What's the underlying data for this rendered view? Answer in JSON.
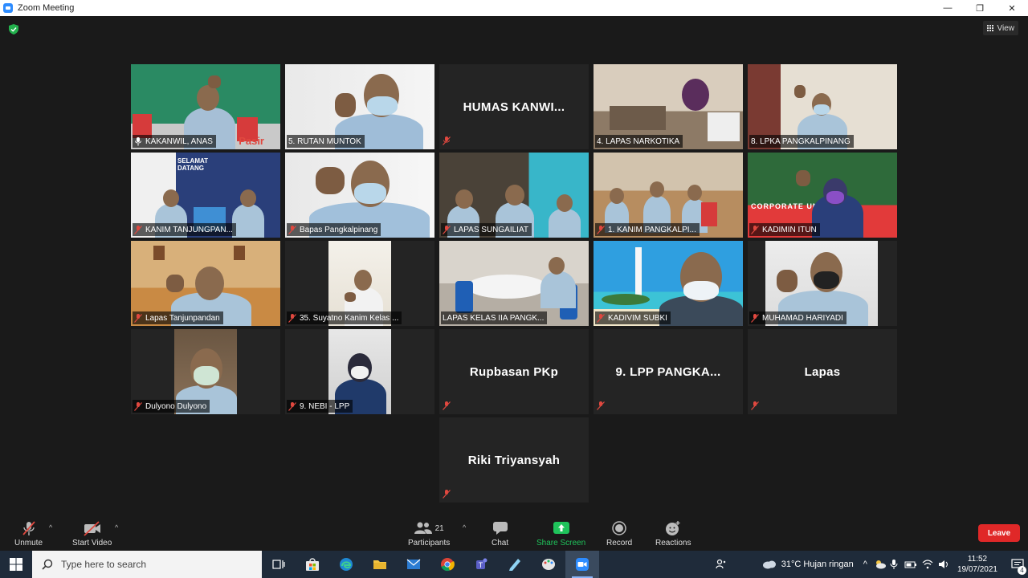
{
  "window": {
    "title": "Zoom Meeting",
    "controls": {
      "minimize": "—",
      "maximize": "❐",
      "close": "✕"
    }
  },
  "view_button": {
    "label": "View"
  },
  "tiles": [
    {
      "label": "KAKANWIL, ANAS",
      "active": true
    },
    {
      "label": "5. RUTAN MUNTOK"
    },
    {
      "name_text": "HUMAS  KANWI..."
    },
    {
      "label": "4. LAPAS NARKOTIKA"
    },
    {
      "label": "8. LPKA PANGKALPINANG"
    },
    {
      "label": "KANIM TANJUNGPAN..."
    },
    {
      "label": "Bapas Pangkalpinang"
    },
    {
      "label": "LAPAS SUNGAILIAT"
    },
    {
      "label": "1. KANIM PANGKALPI..."
    },
    {
      "label": "KADIMIN ITUN"
    },
    {
      "label": "Lapas Tanjunpandan"
    },
    {
      "label": "35. Suyatno Kanim Kelas ..."
    },
    {
      "label": "LAPAS KELAS IIA PANGK..."
    },
    {
      "label": "KADIVIM SUBKI"
    },
    {
      "label": "MUHAMAD HARIYADI"
    },
    {
      "label": "Dulyono Dulyono"
    },
    {
      "label": "9. NEBI - LPP"
    },
    {
      "name_text": "Rupbasan PKp"
    },
    {
      "name_text": "9.  LPP  PANGKA..."
    },
    {
      "name_text": "Lapas"
    },
    {
      "name_text": "Riki Triyansyah"
    }
  ],
  "backdrop_text": {
    "welcome": "SELAMAT DATANG",
    "university": "CORPORATE UNIVERSITY",
    "pasir": "Pasir"
  },
  "toolbar": {
    "unmute": "Unmute",
    "start_video": "Start Video",
    "participants": "Participants",
    "participants_count": "21",
    "chat": "Chat",
    "share_screen": "Share Screen",
    "record": "Record",
    "reactions": "Reactions",
    "leave": "Leave"
  },
  "taskbar": {
    "search_placeholder": "Type here to search",
    "weather": "31°C  Hujan ringan",
    "time": "11:52",
    "date": "19/07/2021",
    "notification_count": "4"
  },
  "colors": {
    "active_speaker": "#d8e34b",
    "share_green": "#1fc35b",
    "leave_red": "#e02828",
    "muted_red": "#e0483f"
  }
}
